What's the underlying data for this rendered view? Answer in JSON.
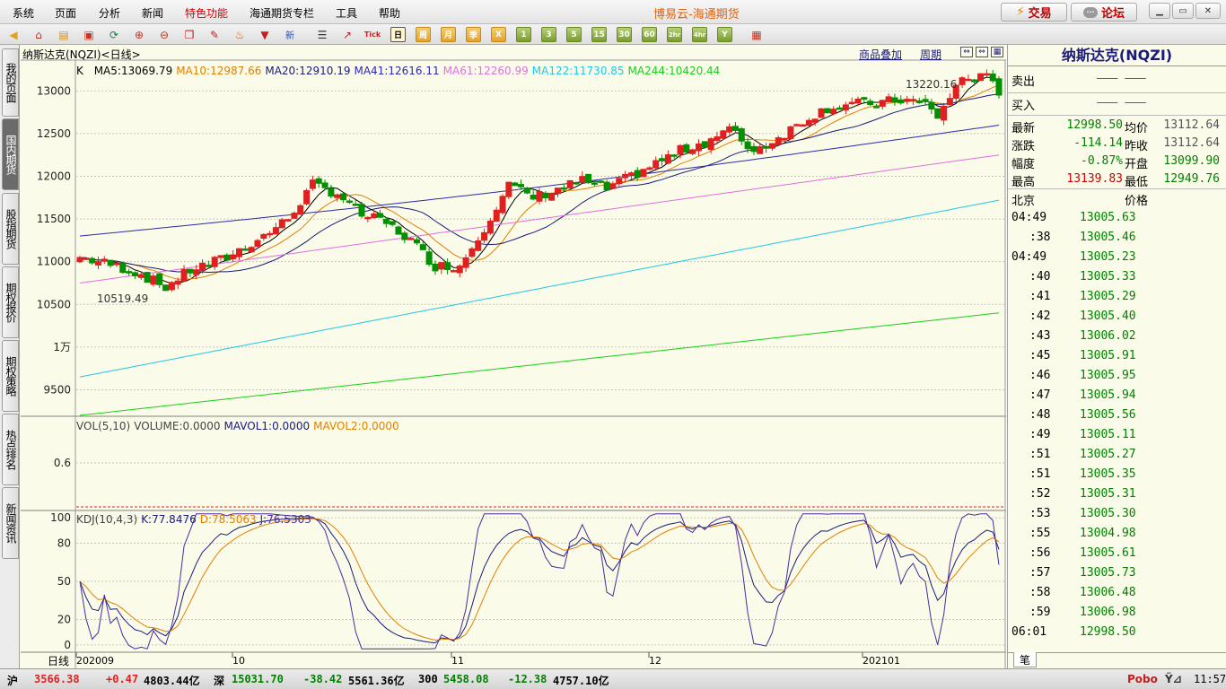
{
  "menu": [
    "系统",
    "页面",
    "分析",
    "新闻",
    "特色功能",
    "海通期货专栏",
    "工具",
    "帮助"
  ],
  "app_title": "博易云-海通期货",
  "trade_button": "交易",
  "forum_button": "论坛",
  "toolbar": {
    "period_buttons": [
      "日",
      "周",
      "月",
      "季",
      "X",
      "1",
      "3",
      "5",
      "15",
      "30",
      "60",
      "2hr",
      "4hr",
      "Y"
    ]
  },
  "left_tabs": [
    "我的页面",
    "国内期货",
    "股指期货",
    "期权报价",
    "期权策略",
    "热点排名",
    "新闻资讯"
  ],
  "chart": {
    "instrument": "纳斯达克(NQZI)<日线>",
    "overlay_link": "商品叠加",
    "period_link": "周期",
    "k_label": "K",
    "ma": [
      {
        "label": "MA5:13069.79",
        "color": "#000000"
      },
      {
        "label": "MA10:12987.66",
        "color": "#e08000"
      },
      {
        "label": "MA20:12910.19",
        "color": "#1a1a7a"
      },
      {
        "label": "MA41:12616.11",
        "color": "#2a2ab0"
      },
      {
        "label": "MA61:12260.99",
        "color": "#e070e0"
      },
      {
        "label": "MA122:11730.85",
        "color": "#20c8e8"
      },
      {
        "label": "MA244:10420.44",
        "color": "#18d018"
      }
    ],
    "high_label": "13220.16",
    "low_label": "10519.49",
    "vol_header": [
      {
        "label": "VOL(5,10)",
        "color": "#444"
      },
      {
        "label": "VOLUME:0.0000",
        "color": "#444"
      },
      {
        "label": "MAVOL1:0.0000",
        "color": "#1a1a7a"
      },
      {
        "label": "MAVOL2:0.0000",
        "color": "#e08000"
      }
    ],
    "vol_tick": "0.6",
    "kdj_header": [
      {
        "label": "KDJ(10,4,3)",
        "color": "#444"
      },
      {
        "label": "K:77.8476",
        "color": "#1a1a7a"
      },
      {
        "label": "D:78.5063",
        "color": "#e08000"
      },
      {
        "label": "J:76.5303",
        "color": "#4a2aa0"
      }
    ],
    "x_axis_label": "日线",
    "x_labels": [
      "202009",
      "10",
      "11",
      "12",
      "202101"
    ]
  },
  "chart_data": [
    {
      "type": "candlestick",
      "title": "纳斯达克(NQZI)<日线>",
      "y_ticks": [
        "13000",
        "12500",
        "12000",
        "11500",
        "11000",
        "10500",
        "1万",
        "9500"
      ],
      "ylim": [
        9200,
        13350
      ],
      "high": 13220.16,
      "low": 10519.49
    },
    {
      "type": "bar",
      "title": "VOL(5,10)",
      "y_ticks": [
        "0.6"
      ]
    },
    {
      "type": "line",
      "title": "KDJ(10,4,3)",
      "y_ticks": [
        "100",
        "80",
        "50",
        "20",
        "0"
      ],
      "ylim": [
        -5,
        105
      ]
    }
  ],
  "quote": {
    "title": "纳斯达克(NQZI)",
    "sell_label": "卖出",
    "sell_value": "——— ———",
    "buy_label": "买入",
    "buy_value": "——— ———",
    "stats": [
      {
        "l1": "最新",
        "v1": "12998.50",
        "c1": "#008000",
        "l2": "均价",
        "v2": "13112.64",
        "c2": "#555"
      },
      {
        "l1": "涨跌",
        "v1": "-114.14",
        "c1": "#008000",
        "l2": "昨收",
        "v2": "13112.64",
        "c2": "#555"
      },
      {
        "l1": "幅度",
        "v1": "-0.87%",
        "c1": "#008000",
        "l2": "开盘",
        "v2": "13099.90",
        "c2": "#008000"
      },
      {
        "l1": "最高",
        "v1": "13139.83",
        "c1": "#d00000",
        "l2": "最低",
        "v2": "12949.76",
        "c2": "#008000"
      }
    ],
    "tick_header_left": "北京",
    "tick_header_right": "价格",
    "ticks": [
      {
        "t": "04:49",
        "p": "13005.63"
      },
      {
        "t": ":38",
        "p": "13005.46"
      },
      {
        "t": "04:49",
        "p": "13005.23"
      },
      {
        "t": ":40",
        "p": "13005.33"
      },
      {
        "t": ":41",
        "p": "13005.29"
      },
      {
        "t": ":42",
        "p": "13005.40"
      },
      {
        "t": ":43",
        "p": "13006.02"
      },
      {
        "t": ":45",
        "p": "13005.91"
      },
      {
        "t": ":46",
        "p": "13005.95"
      },
      {
        "t": ":47",
        "p": "13005.94"
      },
      {
        "t": ":48",
        "p": "13005.56"
      },
      {
        "t": ":49",
        "p": "13005.11"
      },
      {
        "t": ":51",
        "p": "13005.27"
      },
      {
        "t": ":51",
        "p": "13005.35"
      },
      {
        "t": ":52",
        "p": "13005.31"
      },
      {
        "t": ":53",
        "p": "13005.30"
      },
      {
        "t": ":55",
        "p": "13004.98"
      },
      {
        "t": ":56",
        "p": "13005.61"
      },
      {
        "t": ":57",
        "p": "13005.73"
      },
      {
        "t": ":58",
        "p": "13006.48"
      },
      {
        "t": ":59",
        "p": "13006.98"
      },
      {
        "t": "06:01",
        "p": "12998.50"
      }
    ],
    "bottom_tab": "笔"
  },
  "status": {
    "sh_label": "沪",
    "sh_value": "3566.38",
    "sh_change": "+0.47",
    "sh_amount": "4803.44亿",
    "sz_label": "深",
    "sz_value": "15031.70",
    "sz_change": "-38.42",
    "sz_amount": "5561.36亿",
    "i300_label": "300",
    "i300_value": "5458.08",
    "i300_change": "-12.38",
    "i300_amount": "4757.10亿",
    "brand": "Pobo",
    "time": "11:57"
  },
  "colors": {
    "up": "#e02020",
    "down": "#009000",
    "grid": "#c8c8b8",
    "background": "#fbfbe9"
  }
}
